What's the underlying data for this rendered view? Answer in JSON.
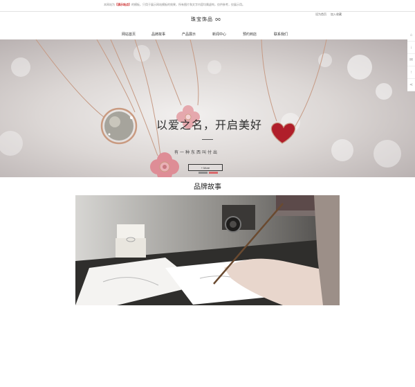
{
  "notice": {
    "prefix": "本网站为",
    "highlight": "【演示站点】",
    "suffix": "的模板，只用于展示网站模板的效果，所有图片和文字内容均属虚构，仅供参考，仅展示用。"
  },
  "utilities": [
    "设为首页",
    "加入收藏"
  ],
  "logo": {
    "text": "珠宝饰品"
  },
  "nav": {
    "items": [
      {
        "label": "网站首页"
      },
      {
        "label": "品牌故事"
      },
      {
        "label": "产品展示"
      },
      {
        "label": "新闻中心"
      },
      {
        "label": "预约到店"
      },
      {
        "label": "联系我们"
      }
    ]
  },
  "hero": {
    "title": "以爱之名，开启美好",
    "subtitle": "有一种东西叫付出",
    "more_label": "+ More",
    "slides_total": 2,
    "active_slide": 2
  },
  "side_tools": {
    "icons": [
      "home-icon",
      "download-icon",
      "mail-icon",
      "upload-icon",
      "share-icon"
    ],
    "glyphs": [
      "⌂",
      "↓",
      "✉",
      "↑",
      "⋖"
    ]
  },
  "brand_story": {
    "title": "品牌故事"
  },
  "colors": {
    "accent": "#d9686b",
    "notice_highlight": "#c81e1e",
    "pendant_red": "#b01e2a"
  }
}
